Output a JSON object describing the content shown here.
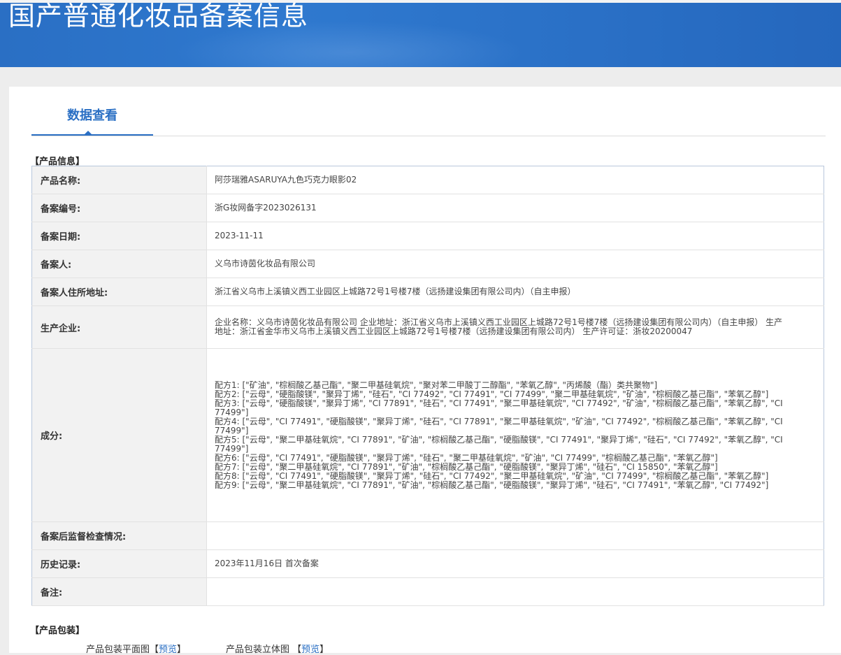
{
  "banner": {
    "title": "国产普通化妆品备案信息"
  },
  "tab": {
    "label": "数据查看"
  },
  "section_product": "【产品信息】",
  "rows": [
    {
      "label": "产品名称:",
      "value": "阿莎瑞雅ASARUYA九色巧克力眼影02"
    },
    {
      "label": "备案编号:",
      "value": "浙G妆网备字2023026131"
    },
    {
      "label": "备案日期:",
      "value": "2023-11-11"
    },
    {
      "label": "备案人:",
      "value": "义乌市诗茵化妆品有限公司"
    },
    {
      "label": "备案人住所地址:",
      "value": "浙江省义乌市上溪镇义西工业园区上城路72号1号楼7楼（远扬建设集团有限公司内）（自主申报）"
    },
    {
      "label": "生产企业:",
      "value": "企业名称：义乌市诗茵化妆品有限公司 企业地址：浙江省义乌市上溪镇义西工业园区上城路72号1号楼7楼（远扬建设集团有限公司内）（自主申报） 生产地址：浙江省金华市义乌市上溪镇义西工业园区上城路72号1号楼7楼（远扬建设集团有限公司内） 生产许可证：浙妆20200047"
    },
    {
      "label": "成分:",
      "formulas": [
        "配方1: [\"矿油\", \"棕榈酸乙基己酯\", \"聚二甲基硅氧烷\", \"聚对苯二甲酸丁二醇酯\", \"苯氧乙醇\", \"丙烯酸（酯）类共聚物\"]",
        "配方2: [\"云母\", \"硬脂酸镁\", \"聚异丁烯\", \"硅石\", \"CI 77492\", \"CI 77491\", \"CI 77499\", \"聚二甲基硅氧烷\", \"矿油\", \"棕榈酸乙基己酯\", \"苯氧乙醇\"]",
        "配方3: [\"云母\", \"硬脂酸镁\", \"聚异丁烯\", \"CI 77891\", \"硅石\", \"CI 77491\", \"聚二甲基硅氧烷\", \"CI 77492\", \"矿油\", \"棕榈酸乙基己酯\", \"苯氧乙醇\", \"CI 77499\"]",
        "配方4: [\"云母\", \"CI 77491\", \"硬脂酸镁\", \"聚异丁烯\", \"硅石\", \"CI 77891\", \"聚二甲基硅氧烷\", \"矿油\", \"CI 77492\", \"棕榈酸乙基己酯\", \"苯氧乙醇\", \"CI 77499\"]",
        "配方5: [\"云母\", \"聚二甲基硅氧烷\", \"CI 77891\", \"矿油\", \"棕榈酸乙基己酯\", \"硬脂酸镁\", \"CI 77491\", \"聚异丁烯\", \"硅石\", \"CI 77492\", \"苯氧乙醇\", \"CI 77499\"]",
        "配方6: [\"云母\", \"CI 77491\", \"硬脂酸镁\", \"聚异丁烯\", \"硅石\", \"聚二甲基硅氧烷\", \"矿油\", \"CI 77499\", \"棕榈酸乙基己酯\", \"苯氧乙醇\"]",
        "配方7: [\"云母\", \"聚二甲基硅氧烷\", \"CI 77891\", \"矿油\", \"棕榈酸乙基己酯\", \"硬脂酸镁\", \"聚异丁烯\", \"硅石\", \"CI 15850\", \"苯氧乙醇\"]",
        "配方8: [\"云母\", \"CI 77491\", \"硬脂酸镁\", \"聚异丁烯\", \"硅石\", \"CI 77492\", \"聚二甲基硅氧烷\", \"矿油\", \"CI 77499\", \"棕榈酸乙基己酯\", \"苯氧乙醇\"]",
        "配方9: [\"云母\", \"聚二甲基硅氧烷\", \"CI 77891\", \"矿油\", \"棕榈酸乙基己酯\", \"硬脂酸镁\", \"聚异丁烯\", \"硅石\", \"CI 77491\", \"苯氧乙醇\", \"CI 77492\"]"
      ]
    },
    {
      "label": "备案后监督检查情况:",
      "value": ""
    },
    {
      "label": "历史记录:",
      "value": "2023年11月16日 首次备案"
    },
    {
      "label": "备注:",
      "value": ""
    }
  ],
  "section_package": "【产品包装】",
  "package": {
    "flat_label": "产品包装平面图",
    "stereo_label": "产品包装立体图",
    "bracket_open": "【",
    "bracket_open_spaced": " 【",
    "preview": "预览",
    "bracket_close": "】"
  }
}
